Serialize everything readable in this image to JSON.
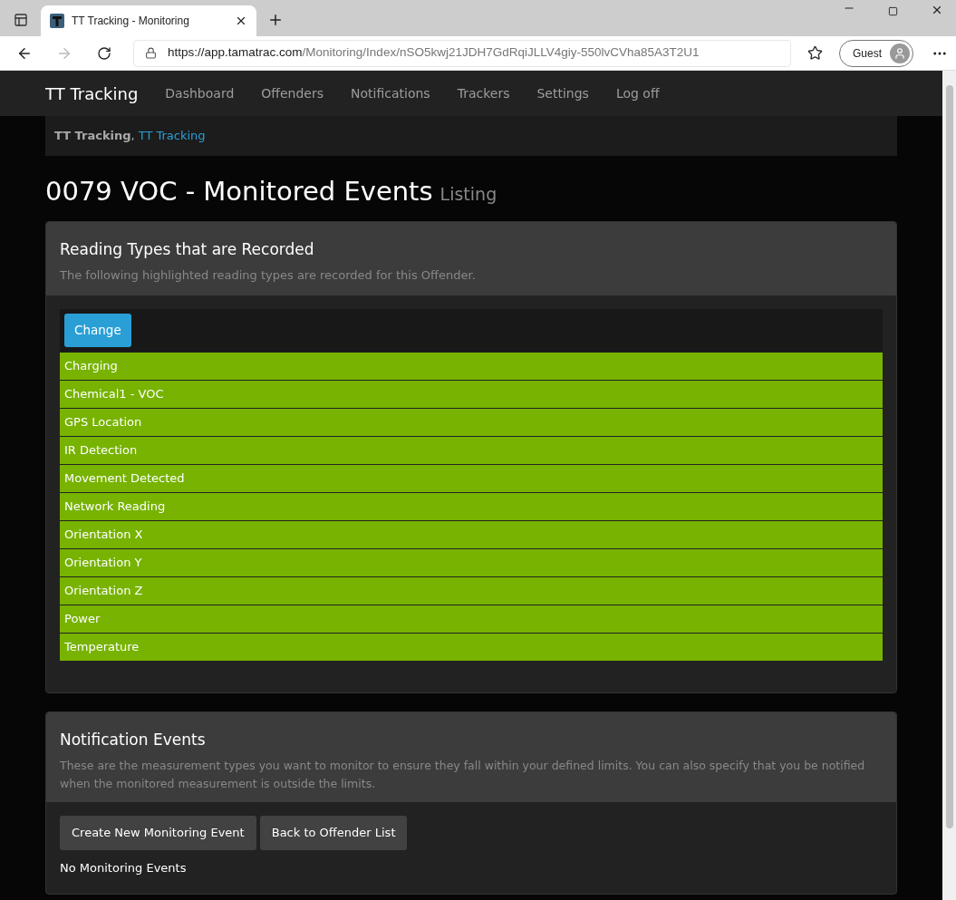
{
  "browser": {
    "tab_title": "TT Tracking - Monitoring",
    "url_host": "https://app.tamatrac.com",
    "url_path": "/Monitoring/Index/nSO5kwj21JDH7GdRqiJLLV4giy-550lvCVha85A3T2U1",
    "profile": "Guest"
  },
  "navbar": {
    "brand": "TT Tracking",
    "links": [
      "Dashboard",
      "Offenders",
      "Notifications",
      "Trackers",
      "Settings",
      "Log off"
    ]
  },
  "breadcrumb": {
    "bold": "TT Tracking",
    "separator": ",",
    "link": "TT Tracking"
  },
  "page": {
    "title": "0079 VOC - Monitored Events",
    "subtitle": "Listing"
  },
  "reading_panel": {
    "title": "Reading Types that are Recorded",
    "description": "The following highlighted reading types are recorded for this Offender.",
    "button": "Change",
    "rows": [
      {
        "label": "Charging",
        "highlighted": true
      },
      {
        "label": "Chemical1 - VOC",
        "highlighted": true
      },
      {
        "label": "GPS Location",
        "highlighted": true
      },
      {
        "label": "IR Detection",
        "highlighted": true
      },
      {
        "label": "Movement Detected",
        "highlighted": true
      },
      {
        "label": "Network Reading",
        "highlighted": true
      },
      {
        "label": "Orientation X",
        "highlighted": true
      },
      {
        "label": "Orientation Y",
        "highlighted": true
      },
      {
        "label": "Orientation Z",
        "highlighted": true
      },
      {
        "label": "Power",
        "highlighted": true
      },
      {
        "label": "Temperature",
        "highlighted": true
      }
    ]
  },
  "notification_panel": {
    "title": "Notification Events",
    "description": "These are the measurement types you want to monitor to ensure they fall within your defined limits. You can also specify that you be notified when the monitored measurement is outside the limits.",
    "buttons": [
      "Create New Monitoring Event",
      "Back to Offender List"
    ],
    "empty_text": "No Monitoring Events"
  }
}
